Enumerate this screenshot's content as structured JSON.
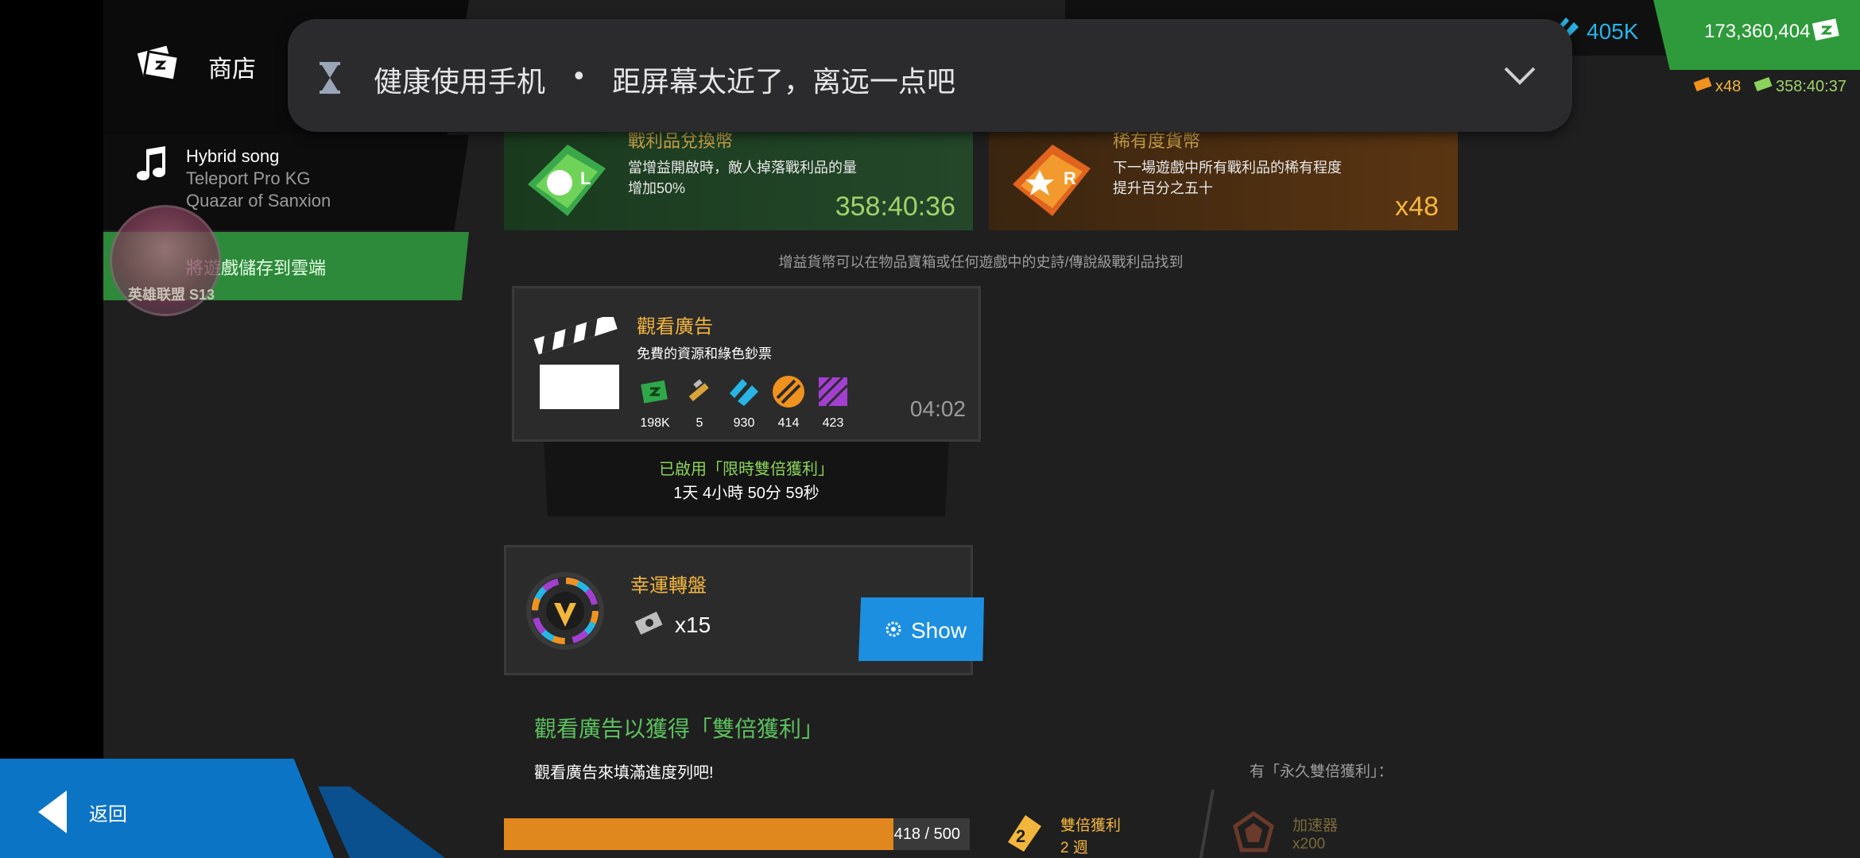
{
  "nav": {
    "shop_label": "商店",
    "song": {
      "title": "Hybrid song",
      "artist": "Teleport Pro KG",
      "album": "Quazar of Sanxion"
    },
    "cloud_save_label": "將遊戲儲存到雲端",
    "avatar_text": "英雄联盟 S13",
    "back_label": "返回"
  },
  "notification": {
    "title": "健康使用手机",
    "separator": "•",
    "message": "距屏幕太近了，离远一点吧"
  },
  "currencies": {
    "cyan_value": "405K",
    "cash_value": "173,360,404",
    "loot_ticket_count": "x48",
    "loot_timer": "358:40:37"
  },
  "tokens": {
    "loot": {
      "title": "戰利品兌換幣",
      "description": "當增益開啟時，敵人掉落戰利品的量增加50%",
      "timer": "358:40:36",
      "icon_letter": "L"
    },
    "rarity": {
      "title": "稀有度貨幣",
      "description": "下一場遊戲中所有戰利品的稀有程度提升百分之五十",
      "count": "x48",
      "icon_letter": "R"
    },
    "info": "增益貨幣可以在物品寶箱或任何遊戲中的史詩/傳說級戰利品找到"
  },
  "ad": {
    "title": "觀看廣告",
    "subtitle": "免費的資源和綠色鈔票",
    "timer": "04:02",
    "rewards": [
      {
        "icon": "cash-icon",
        "value": "198K",
        "color": "#2fa84a"
      },
      {
        "icon": "syringe-icon",
        "value": "5",
        "color": "#d9a33a"
      },
      {
        "icon": "cyan-currency-icon",
        "value": "930",
        "color": "#27b5e6"
      },
      {
        "icon": "orange-currency-icon",
        "value": "414",
        "color": "#f0921e"
      },
      {
        "icon": "purple-currency-icon",
        "value": "423",
        "color": "#a23fd0"
      }
    ],
    "double_active": "已啟用「限時雙倍獲利」",
    "double_remaining": "1天 4小時 50分 59秒"
  },
  "wheel": {
    "title": "幸運轉盤",
    "count": "x15",
    "show_label": "Show"
  },
  "double_gain": {
    "title": "觀看廣告以獲得「雙倍獲利」",
    "subtitle": "觀看廣告來填滿進度列吧!",
    "permanent_label": "有「永久雙倍獲利」：",
    "progress_text": "418 / 500",
    "progress_fraction": 0.836,
    "reward1_label": "雙倍獲利",
    "reward1_value": "2 週",
    "reward2_label": "加速器",
    "reward2_value": "x200"
  },
  "colors": {
    "accent_yellow": "#f3b63d",
    "accent_green": "#5cc05e",
    "accent_blue": "#1c8fe0",
    "cash_green": "#2f9a3b"
  }
}
